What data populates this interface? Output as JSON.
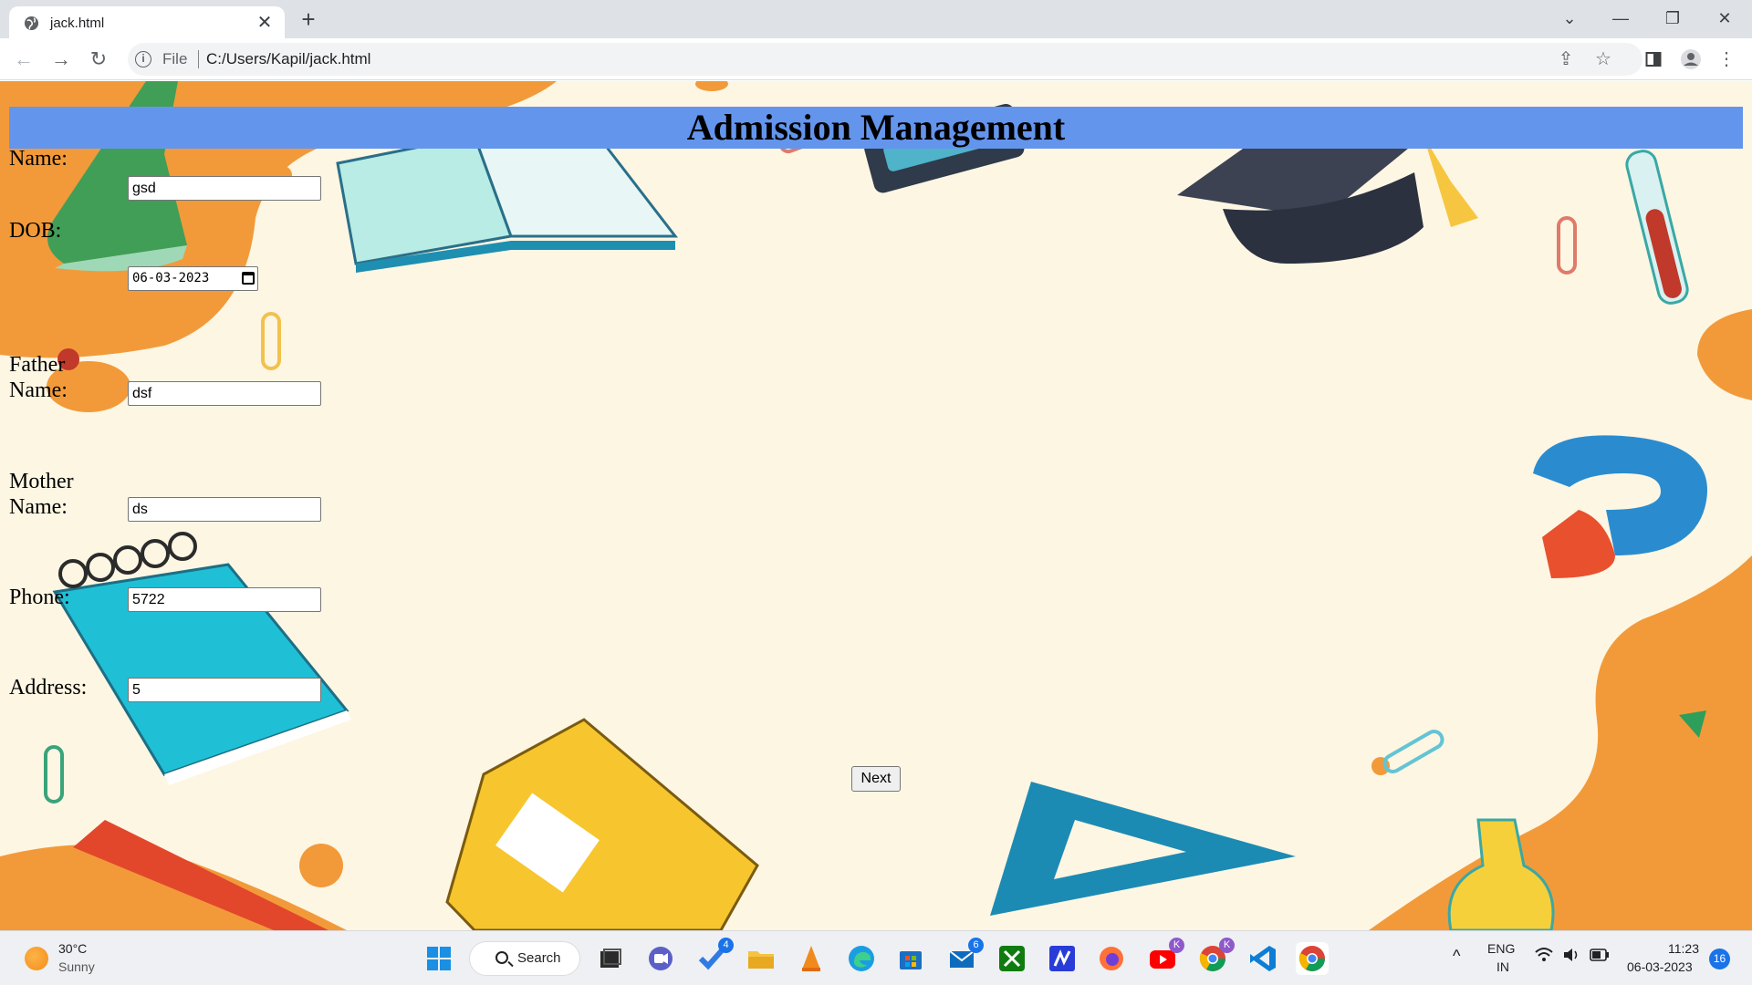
{
  "browser": {
    "tab_title": "jack.html",
    "file_label": "File",
    "url": "C:/Users/Kapil/jack.html"
  },
  "page": {
    "heading": "Admission Management",
    "fields": [
      {
        "label": "Name:",
        "value": "gsd"
      },
      {
        "label": "DOB:",
        "value": "06-03-2023"
      },
      {
        "label": "Father Name:",
        "value": "dsf"
      },
      {
        "label": "Mother Name:",
        "value": "ds"
      },
      {
        "label": "Phone:",
        "value": "5722"
      },
      {
        "label": "Address:",
        "value": "5"
      }
    ],
    "next_button": "Next"
  },
  "taskbar": {
    "weather_temp": "30°C",
    "weather_condition": "Sunny",
    "search_label": "Search",
    "badges": {
      "todo": "4",
      "mail": "6",
      "youtube": "K",
      "chrome_profile": "K"
    },
    "language": "ENG",
    "region": "IN",
    "time": "11:23",
    "date": "06-03-2023",
    "notifications": "16"
  },
  "colors": {
    "header_bg": "#6495ed",
    "page_bg": "#fdf6e3",
    "blob_orange": "#f29a3a"
  }
}
